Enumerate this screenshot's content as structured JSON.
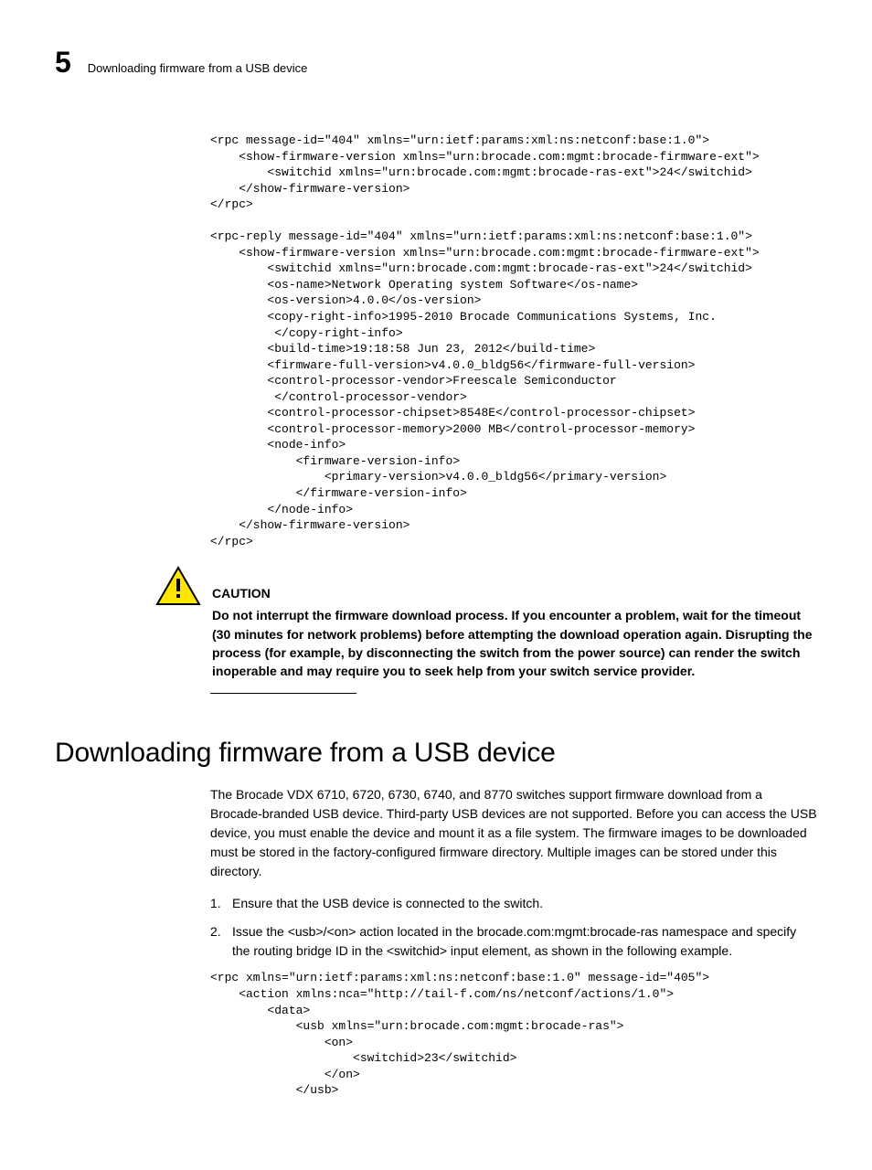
{
  "header": {
    "chapter_number": "5",
    "running_title": "Downloading firmware from a USB device"
  },
  "code_block_1": "<rpc message-id=\"404\" xmlns=\"urn:ietf:params:xml:ns:netconf:base:1.0\">\n    <show-firmware-version xmlns=\"urn:brocade.com:mgmt:brocade-firmware-ext\">\n        <switchid xmlns=\"urn:brocade.com:mgmt:brocade-ras-ext\">24</switchid>\n    </show-firmware-version>\n</rpc>\n\n<rpc-reply message-id=\"404\" xmlns=\"urn:ietf:params:xml:ns:netconf:base:1.0\">\n    <show-firmware-version xmlns=\"urn:brocade.com:mgmt:brocade-firmware-ext\">\n        <switchid xmlns=\"urn:brocade.com:mgmt:brocade-ras-ext\">24</switchid>\n        <os-name>Network Operating system Software</os-name>\n        <os-version>4.0.0</os-version>\n        <copy-right-info>1995-2010 Brocade Communications Systems, Inc.\n         </copy-right-info>\n        <build-time>19:18:58 Jun 23, 2012</build-time>\n        <firmware-full-version>v4.0.0_bldg56</firmware-full-version>\n        <control-processor-vendor>Freescale Semiconductor\n         </control-processor-vendor>\n        <control-processor-chipset>8548E</control-processor-chipset>\n        <control-processor-memory>2000 MB</control-processor-memory>\n        <node-info>\n            <firmware-version-info>\n                <primary-version>v4.0.0_bldg56</primary-version>\n            </firmware-version-info>\n        </node-info>\n    </show-firmware-version>\n</rpc>",
  "caution": {
    "label": "CAUTION",
    "text": "Do not interrupt the firmware download process. If you encounter a problem, wait for the timeout (30 minutes for network problems) before attempting the download operation again. Disrupting the process (for example, by disconnecting the switch from the power source) can render the switch inoperable and may require you to seek help from your switch service provider."
  },
  "section": {
    "title": "Downloading firmware from a USB device",
    "intro": "The Brocade VDX 6710, 6720, 6730, 6740, and 8770 switches support firmware download from a Brocade-branded USB device. Third-party USB devices are not supported. Before you can access the USB device, you must enable the device and mount it as a file system. The firmware images to be downloaded must be stored in the factory-configured firmware directory. Multiple images can be stored under this directory.",
    "steps": [
      "Ensure that the USB device is connected to the switch.",
      "Issue the <usb>/<on> action located in the brocade.com:mgmt:brocade-ras namespace and specify the routing bridge ID in the <switchid> input element, as shown in the following example."
    ]
  },
  "code_block_2": "<rpc xmlns=\"urn:ietf:params:xml:ns:netconf:base:1.0\" message-id=\"405\">\n    <action xmlns:nca=\"http://tail-f.com/ns/netconf/actions/1.0\">\n        <data>\n            <usb xmlns=\"urn:brocade.com:mgmt:brocade-ras\">\n                <on>\n                    <switchid>23</switchid>\n                </on>\n            </usb>"
}
